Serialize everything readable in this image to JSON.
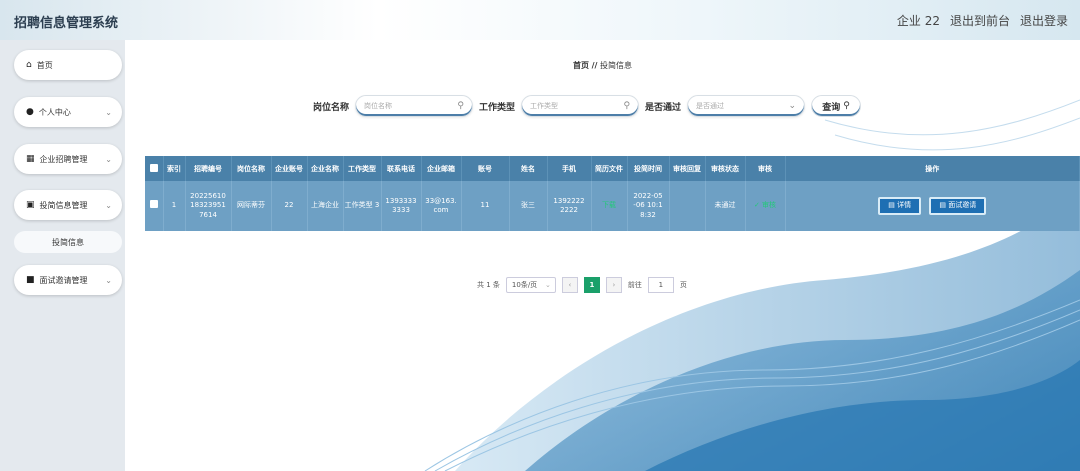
{
  "app": {
    "title": "招聘信息管理系统"
  },
  "header": {
    "user": "企业 22",
    "back_to_front": "退出到前台",
    "logout": "退出登录"
  },
  "sidebar": {
    "items": [
      {
        "label": "首页",
        "icon": "home-icon"
      },
      {
        "label": "个人中心",
        "icon": "user-icon"
      },
      {
        "label": "企业招聘管理",
        "icon": "grid-icon"
      },
      {
        "label": "投简信息管理",
        "icon": "clipboard-icon"
      },
      {
        "label": "面试邀请管理",
        "icon": "briefcase-icon"
      }
    ],
    "submenu": {
      "label": "投简信息"
    }
  },
  "breadcrumb": {
    "home": "首页",
    "sep": "//",
    "current": "投简信息"
  },
  "search": {
    "position_label": "岗位名称",
    "position_placeholder": "岗位名称",
    "type_label": "工作类型",
    "type_placeholder": "工作类型",
    "pass_label": "是否通过",
    "pass_placeholder": "是否通过",
    "query_label": "查询"
  },
  "table": {
    "headers": [
      "索引",
      "招聘编号",
      "岗位名称",
      "企业账号",
      "企业名称",
      "工作类型",
      "联系电话",
      "企业邮箱",
      "账号",
      "姓名",
      "手机",
      "简历文件",
      "投简时间",
      "审核回复",
      "审核状态",
      "审核",
      "操作"
    ],
    "rows": [
      {
        "index": "1",
        "job_no": "20225610 18323951 7614",
        "position": "网际蒂芬",
        "company_account": "22",
        "company_name": "上海企业",
        "job_type": "工作类型 3",
        "phone": "1393333 3333",
        "email": "33@163. com",
        "account": "11",
        "name": "张三",
        "mobile": "1392222 2222",
        "resume": "下载",
        "time": "2022-05 -06 10:1 8:32",
        "reply": "",
        "status": "未通过",
        "audit": "审核",
        "detail_label": "详情",
        "invite_label": "面试邀请"
      }
    ]
  },
  "pagination": {
    "total": "共 1 条",
    "per_page": "10条/页",
    "current": "1",
    "goto": "前往",
    "goto_value": "1",
    "page_unit": "页"
  },
  "colors": {
    "header_bg": "#4a81a9",
    "row_bg": "#6ea0c4",
    "accent_green": "#1aa06a",
    "button_blue": "#1e6fb3"
  }
}
